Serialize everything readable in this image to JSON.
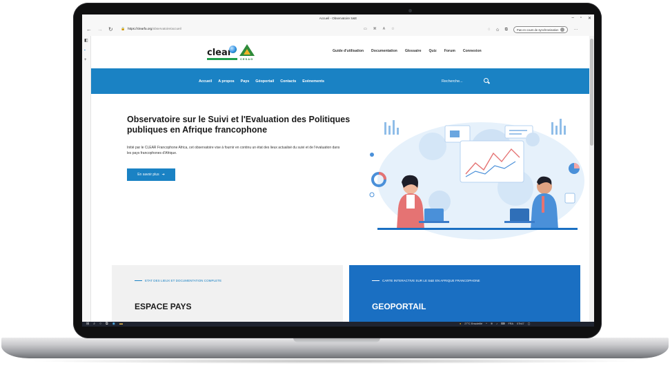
{
  "browser": {
    "tab_title": "Accueil - Observatoire S&E",
    "url_host": "https://clearfa.org",
    "url_path": "/observatoire/accueil",
    "sync_label": "Pas en cours de synchronisation"
  },
  "site": {
    "logo_text": "clear",
    "logo_sub": "CESAG",
    "top_nav": [
      "Guide d'utilisation",
      "Documentation",
      "Glossaire",
      "Quiz",
      "Forum",
      "Connexion"
    ],
    "main_nav": [
      "Accueil",
      "A propos",
      "Pays",
      "Géoportail",
      "Contacts",
      "Evénements"
    ],
    "search_label": "Recherche...",
    "colors": {
      "primary_blue": "#1a82c4",
      "card_blue": "#1a6fc2"
    }
  },
  "hero": {
    "title": "Observatoire sur le Suivi et l'Evaluation des Politiques publiques en Afrique francophone",
    "text": "Initié par le CLEAR Francophone Africa, cet observatoire vise à fournir en continu un état des lieux actualisé du suivi et de l'évaluation dans les pays francophones d'Afrique.",
    "cta_label": "En savoir plus"
  },
  "cards": [
    {
      "kicker": "ETAT DES LIEUX ET DOCUMENTATION COMPLETE",
      "title": "ESPACE PAYS"
    },
    {
      "kicker": "CARTE INTERACTIVE SUR LE S&E EN AFRIQUE FRANCOPHONE",
      "title": "GEOPORTAIL"
    }
  ],
  "taskbar": {
    "weather": "27°C Ensoleillé",
    "lang": "FRA",
    "time": "07h47"
  }
}
